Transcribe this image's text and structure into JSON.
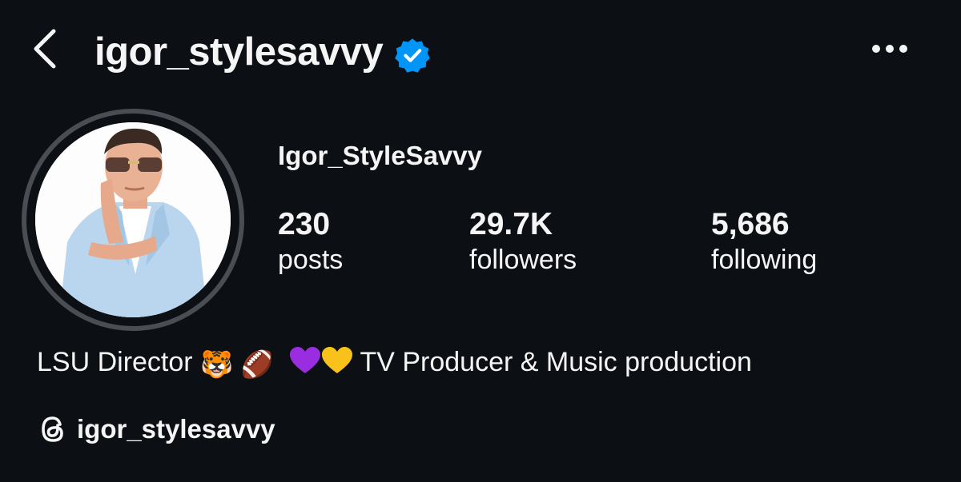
{
  "header": {
    "username": "igor_stylesavvy",
    "back_icon": "chevron-left-icon",
    "verified_icon": "verified-badge-icon",
    "more_icon": "more-horizontal-icon"
  },
  "profile": {
    "display_name": "Igor_StyleSavvy",
    "stats": {
      "posts": {
        "value": "230",
        "label": "posts"
      },
      "followers": {
        "value": "29.7K",
        "label": "followers"
      },
      "following": {
        "value": "5,686",
        "label": "following"
      }
    },
    "bio": {
      "prefix": "LSU Director",
      "emojis": [
        "🐯",
        "🏈",
        "💜",
        "💛"
      ],
      "suffix": "TV Producer & Music production"
    },
    "threads": {
      "handle": "igor_stylesavvy",
      "icon": "threads-icon"
    }
  },
  "colors": {
    "background": "#0c1014",
    "text": "#f5f5f5",
    "verified": "#0095f6",
    "ring": "#4a4e54",
    "purple_heart": "#9b2de0",
    "yellow_heart": "#f9c21a"
  }
}
